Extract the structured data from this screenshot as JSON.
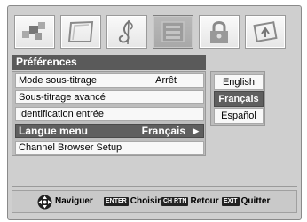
{
  "tabs": [
    {
      "icon": "picture-icon",
      "active": false
    },
    {
      "icon": "screen-icon",
      "active": false
    },
    {
      "icon": "music-note-icon",
      "active": false
    },
    {
      "icon": "preferences-icon",
      "active": true
    },
    {
      "icon": "lock-icon",
      "active": false
    },
    {
      "icon": "setup-icon",
      "active": false
    }
  ],
  "panel": {
    "title": "Préférences"
  },
  "menu": [
    {
      "label": "Mode sous-titrage",
      "value": "Arrêt"
    },
    {
      "label": "Sous-titrage avancé",
      "value": ""
    },
    {
      "label": "Identification entrée",
      "value": ""
    },
    {
      "label": "Langue menu",
      "value": "Français",
      "selected": true
    },
    {
      "label": "Channel Browser Setup",
      "value": ""
    }
  ],
  "languages": {
    "options": [
      "English",
      "Français",
      "Español"
    ],
    "selected": "Français"
  },
  "footer": {
    "navigate": "Naviguer",
    "enter_key": "ENTER",
    "choose": "Choisir",
    "return_key": "CH RTN",
    "back": "Retour",
    "exit_key": "EXIT",
    "quit": "Quitter"
  },
  "colors": {
    "background": "#cfcfcf",
    "title_bar": "#5a5a5a",
    "selected": "#5f5f5f",
    "item": "#f8f8f8"
  }
}
